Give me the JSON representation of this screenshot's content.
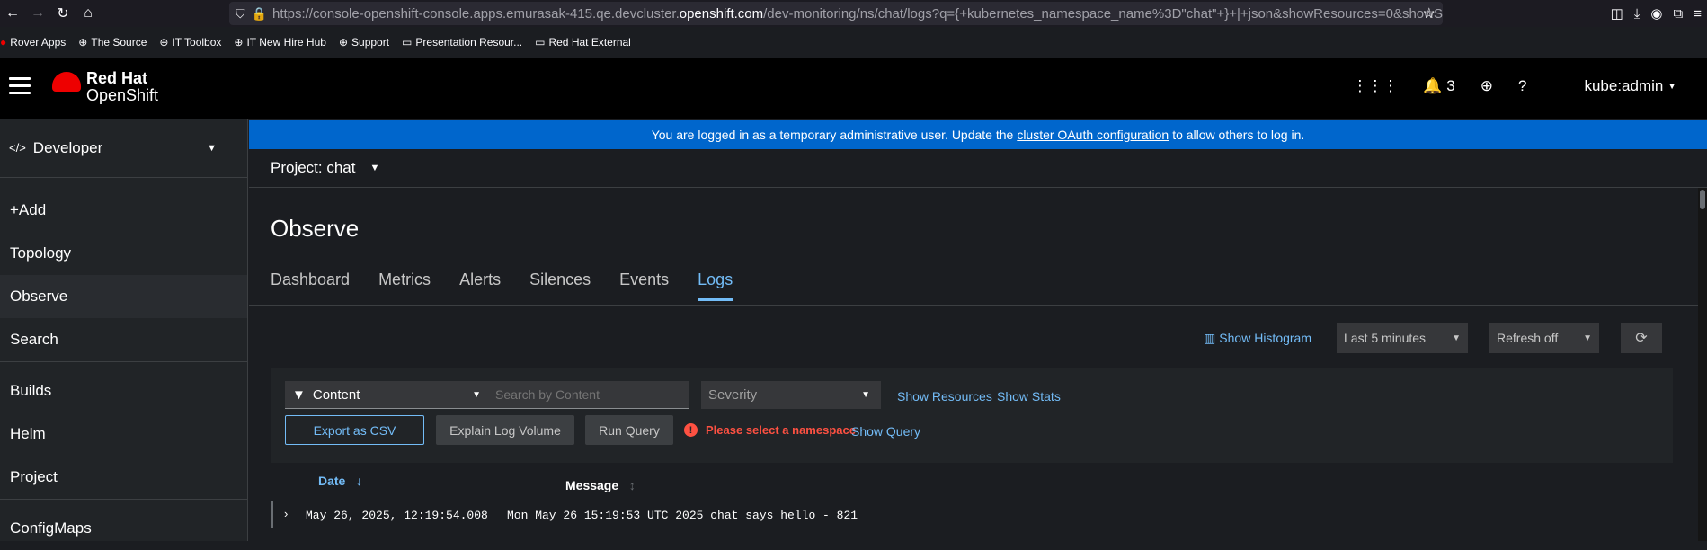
{
  "browser": {
    "url_prefix": "https://console-openshift-console.apps.emurasak-415.qe.devcluster.",
    "url_domain": "openshift.com",
    "url_suffix": "/dev-monitoring/ns/chat/logs?q={+kubernetes_namespace_name%3D\"chat\"+}+|+json&showResources=0&showS"
  },
  "bookmarks": [
    {
      "label": "Rover Apps",
      "icon": "redhat-icon"
    },
    {
      "label": "The Source",
      "icon": "globe-icon"
    },
    {
      "label": "IT Toolbox",
      "icon": "globe-icon"
    },
    {
      "label": "IT New Hire Hub",
      "icon": "globe-icon"
    },
    {
      "label": "Support",
      "icon": "globe-icon"
    },
    {
      "label": "Presentation Resour...",
      "icon": "folder-icon"
    },
    {
      "label": "Red Hat External",
      "icon": "folder-icon"
    }
  ],
  "masthead": {
    "brand_top": "Red Hat",
    "brand_bottom": "OpenShift",
    "notifications_count": "3",
    "user": "kube:admin"
  },
  "sidebar": {
    "perspective": "Developer",
    "items": [
      "+Add",
      "Topology",
      "Observe",
      "Search",
      "Builds",
      "Helm",
      "Project",
      "ConfigMaps"
    ],
    "active": "Observe"
  },
  "banner": {
    "before": "You are logged in as a temporary administrative user. Update the",
    "link": "cluster OAuth configuration",
    "after": "to allow others to log in."
  },
  "project": {
    "label": "Project: chat"
  },
  "page": {
    "title": "Observe",
    "tabs": [
      "Dashboard",
      "Metrics",
      "Alerts",
      "Silences",
      "Events",
      "Logs"
    ],
    "selected_tab": "Logs"
  },
  "toolbar": {
    "histogram": "Show Histogram",
    "time_range": "Last 5 minutes",
    "refresh": "Refresh off"
  },
  "filters": {
    "attribute": "Content",
    "search_placeholder": "Search by Content",
    "severity_placeholder": "Severity",
    "show_resources": "Show Resources",
    "show_stats": "Show Stats",
    "export": "Export as CSV",
    "explain": "Explain Log Volume",
    "run": "Run Query",
    "error": "Please select a namespace",
    "show_query": "Show Query"
  },
  "table": {
    "col_date": "Date",
    "col_message": "Message",
    "rows": [
      {
        "date": "May 26, 2025, 12:19:54.008",
        "message": "Mon May 26 15:19:53 UTC 2025 chat says hello - 821"
      }
    ]
  },
  "colors": {
    "accent": "#73bcf7",
    "banner": "#0066cc",
    "error": "#fe5142",
    "brand": "#ee0000"
  }
}
